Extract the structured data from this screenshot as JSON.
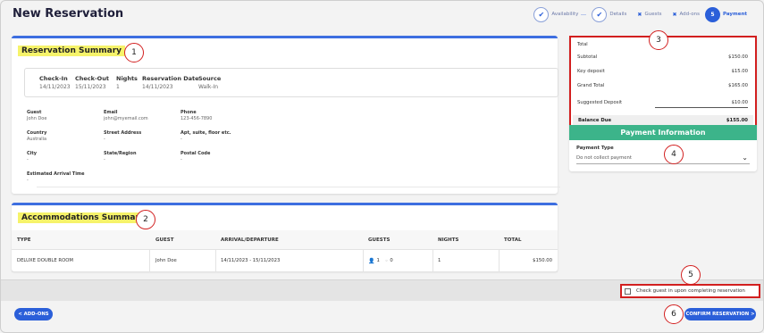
{
  "page": {
    "title": "New Reservation"
  },
  "stepper": {
    "steps": [
      {
        "label": "Availability",
        "state": "done"
      },
      {
        "label": "Details",
        "state": "done"
      },
      {
        "label": "Guests",
        "state": "skipped"
      },
      {
        "label": "Add-ons",
        "state": "skipped"
      },
      {
        "label": "Payment",
        "state": "active",
        "number": "5"
      }
    ]
  },
  "callouts": [
    "1",
    "2",
    "3",
    "4",
    "5",
    "6"
  ],
  "reservation_summary": {
    "heading": "Reservation Summary",
    "booking": [
      {
        "label": "Check-In",
        "value": "14/11/2023"
      },
      {
        "label": "Check-Out",
        "value": "15/11/2023"
      },
      {
        "label": "Nights",
        "value": "1"
      },
      {
        "label": "Reservation Date",
        "value": "14/11/2023"
      },
      {
        "label": "Source",
        "value": "Walk-In"
      }
    ],
    "guest_info": [
      {
        "label": "Guest",
        "value": "John Doe"
      },
      {
        "label": "Email",
        "value": "john@myemail.com"
      },
      {
        "label": "Phone",
        "value": "123-456-7890"
      },
      {
        "label": "Country",
        "value": "Australia"
      },
      {
        "label": "Street Address",
        "value": "-"
      },
      {
        "label": "Apt, suite, floor etc.",
        "value": "-"
      },
      {
        "label": "City",
        "value": "-"
      },
      {
        "label": "State/Region",
        "value": "-"
      },
      {
        "label": "Postal Code",
        "value": "-"
      },
      {
        "label": "Estimated Arrival Time",
        "value": "-"
      }
    ]
  },
  "totals": {
    "label": "Total",
    "rows": [
      {
        "label": "Subtotal",
        "value": "$150.00"
      },
      {
        "label": "Key deposit",
        "value": "$15.00"
      },
      {
        "label": "Grand Total",
        "value": "$165.00"
      },
      {
        "label": "Suggested Deposit",
        "value": "$10.00"
      }
    ],
    "balance_label": "Balance Due",
    "balance_value": "$155.00"
  },
  "payment": {
    "heading": "Payment Information",
    "type_label": "Payment Type",
    "type_value": "Do not collect payment"
  },
  "accommodations": {
    "heading": "Accommodations Summary",
    "columns": [
      "TYPE",
      "GUEST",
      "ARRIVAL/DEPARTURE",
      "GUESTS",
      "NIGHTS",
      "TOTAL"
    ],
    "row": {
      "type": "DELUXE DOUBLE ROOM",
      "guest": "John Doe",
      "dates": "14/11/2023 - 15/11/2023",
      "adults": "1",
      "children": "0",
      "nights": "1",
      "total": "$150.00"
    }
  },
  "footer": {
    "checkin_label": "Check guest in upon completing reservation",
    "back_label": "< ADD-ONS",
    "confirm_label": "CONFIRM RESERVATION >"
  },
  "colors": {
    "accent": "#2b5fd9",
    "payment_header": "#3cb48a",
    "callout": "#d21f1f",
    "highlight": "#f6f36a"
  }
}
